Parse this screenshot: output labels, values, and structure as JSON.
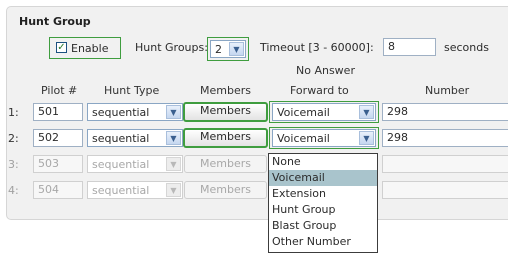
{
  "section_title": "Hunt Group",
  "enable": {
    "label": "Enable",
    "checked_mark": "✓"
  },
  "hunt_groups": {
    "label": "Hunt Groups:",
    "value": "2"
  },
  "timeout": {
    "label": "Timeout [3 - 60000]:",
    "value": "8",
    "unit": "seconds"
  },
  "columns": {
    "pilot": "Pilot #",
    "hunt_type": "Hunt Type",
    "members": "Members",
    "no_answer_line1": "No Answer",
    "no_answer_line2": "Forward to",
    "number": "Number"
  },
  "rows": [
    {
      "label": "1:",
      "pilot": "501",
      "hunt_type": "sequential",
      "members_button": "Members",
      "forward": "Voicemail",
      "number": "298"
    },
    {
      "label": "2:",
      "pilot": "502",
      "hunt_type": "sequential",
      "members_button": "Members",
      "forward": "Voicemail",
      "number": "298"
    },
    {
      "label": "3:",
      "pilot": "503",
      "hunt_type": "sequential",
      "members_button": "Members",
      "forward": "",
      "number": ""
    },
    {
      "label": "4:",
      "pilot": "504",
      "hunt_type": "sequential",
      "members_button": "Members",
      "forward": "",
      "number": ""
    }
  ],
  "forward_options": [
    "None",
    "Voicemail",
    "Extension",
    "Hunt Group",
    "Blast Group",
    "Other Number"
  ],
  "forward_selected": "Voicemail",
  "icons": {
    "dropdown_arrow": "chevron-down-icon",
    "checkbox": "check-icon"
  },
  "colors": {
    "highlight_border": "#3f9d3f",
    "selected_option_bg": "#a9c4cc"
  }
}
